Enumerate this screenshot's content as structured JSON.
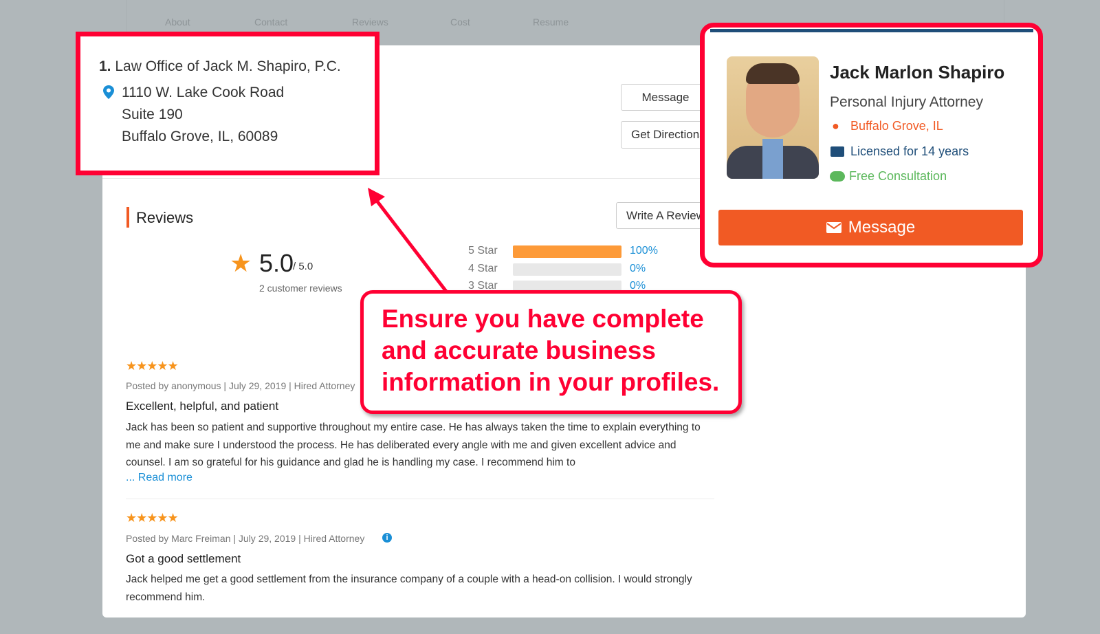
{
  "nav": {
    "items": [
      "About",
      "Contact",
      "Reviews",
      "Cost",
      "Resume"
    ]
  },
  "listing": {
    "number": "1.",
    "name": "Law Office of Jack M. Shapiro, P.C.",
    "address": [
      "1110 W. Lake Cook Road",
      "Suite 190",
      "Buffalo Grove, IL, 60089"
    ]
  },
  "actions": {
    "message": "Message",
    "directions": "Get Directions"
  },
  "reviews": {
    "heading": "Reviews",
    "write_review": "Write A Review",
    "rating": "5.0",
    "rating_max": "/ 5.0",
    "count": "2 customer reviews",
    "breakdown": [
      {
        "label": "5 Star",
        "percent": 100,
        "pct_text": "100%"
      },
      {
        "label": "4 Star",
        "percent": 0,
        "pct_text": "0%"
      },
      {
        "label": "3 Star",
        "percent": 0,
        "pct_text": "0%"
      }
    ],
    "items": [
      {
        "stars": 5,
        "meta": "Posted by anonymous | July 29, 2019 | Hired Attorney",
        "title": "Excellent, helpful, and patient",
        "body": "Jack has been so patient and supportive throughout my entire case. He has always taken the time to explain everything to me and make sure I understood the process. He has deliberated every angle with me and given excellent advice and counsel. I am so grateful for his guidance and glad he is handling my case. I recommend him to",
        "read_more": "... Read more"
      },
      {
        "stars": 5,
        "meta": "Posted by Marc Freiman | July 29, 2019 | Hired Attorney",
        "title": "Got a good settlement",
        "body": "Jack helped me get a good settlement from the insurance company of a couple with a head-on collision. I would strongly recommend him."
      }
    ]
  },
  "callout": {
    "text": "Ensure you have complete and accurate business information in your profiles."
  },
  "profile": {
    "name": "Jack Marlon Shapiro",
    "title": "Personal Injury Attorney",
    "location": "Buffalo Grove, IL",
    "licensed": "Licensed for 14 years",
    "consultation": "Free Consultation",
    "message": "Message"
  },
  "colors": {
    "annotation": "#ff0033",
    "accent": "#f15a24",
    "star": "#f7941d",
    "link": "#1a8fd6",
    "green": "#5cb85c",
    "navy": "#1f4e79"
  }
}
